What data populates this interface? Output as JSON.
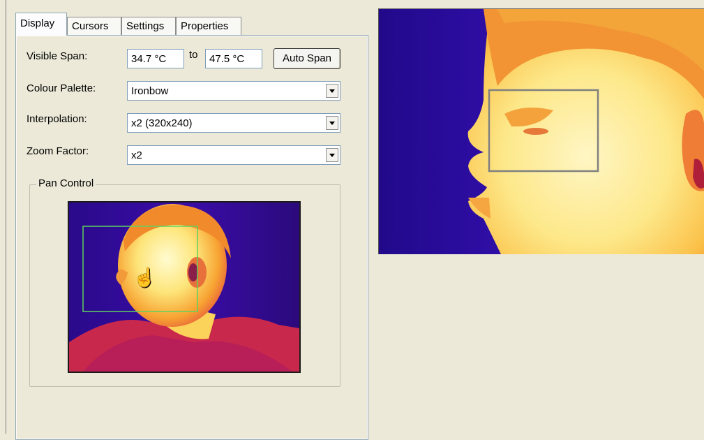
{
  "tabs": [
    {
      "label": "Display",
      "active": true
    },
    {
      "label": "Cursors",
      "active": false
    },
    {
      "label": "Settings",
      "active": false
    },
    {
      "label": "Properties",
      "active": false
    }
  ],
  "display": {
    "visible_span_label": "Visible Span:",
    "span_min": "34.7 °C",
    "to_label": "to",
    "span_max": "47.5 °C",
    "auto_span_button": "Auto Span",
    "colour_palette_label": "Colour Palette:",
    "colour_palette_value": "Ironbow",
    "interpolation_label": "Interpolation:",
    "interpolation_value": "x2 (320x240)",
    "zoom_factor_label": "Zoom Factor:",
    "zoom_factor_value": "x2",
    "pan_control_label": "Pan Control"
  },
  "icons": {
    "dropdown": "chevron-down-icon",
    "cursor": "hand-pointer-icon"
  },
  "colors": {
    "background": "#ece9d8",
    "pan_rect": "#5fd35f",
    "view_rect": "#808080"
  }
}
